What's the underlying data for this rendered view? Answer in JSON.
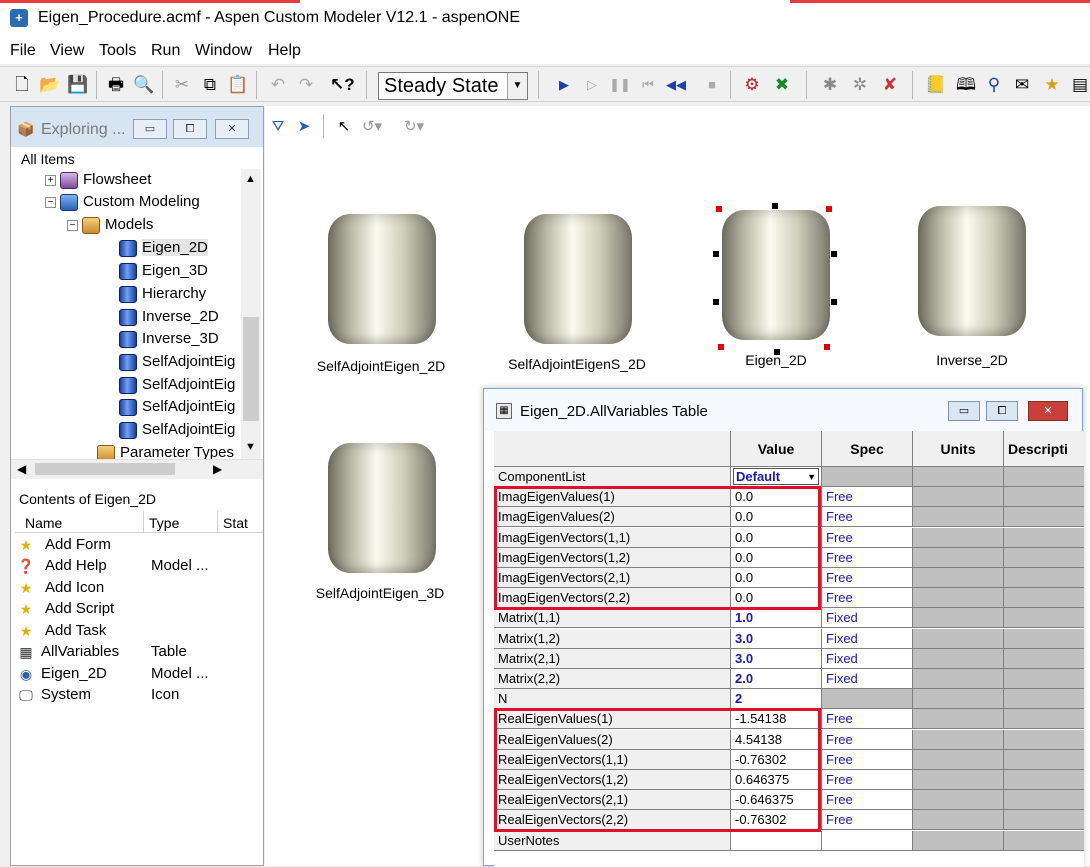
{
  "title_bar": {
    "title": "Eigen_Procedure.acmf - Aspen Custom Modeler V12.1 - aspenONE"
  },
  "menu": {
    "items": [
      "File",
      "Edit",
      "View",
      "Tools",
      "Run",
      "Window",
      "Help"
    ]
  },
  "toolbar": {
    "run_mode": "Steady State"
  },
  "explorer": {
    "caption": "Exploring ...",
    "all_items_label": "All Items",
    "tree": {
      "flowsheet": "Flowsheet",
      "custom_modeling": "Custom Modeling",
      "models": "Models",
      "model_items": [
        "Eigen_2D",
        "Eigen_3D",
        "Hierarchy",
        "Inverse_2D",
        "Inverse_3D",
        "SelfAdjointEig",
        "SelfAdjointEig",
        "SelfAdjointEig",
        "SelfAdjointEig"
      ],
      "parameter_types": "Parameter Types"
    },
    "contents_label": "Contents of Eigen_2D",
    "columns": {
      "name": "Name",
      "type": "Type",
      "status": "Stat"
    },
    "contents": [
      {
        "name": "Add Form",
        "type": ""
      },
      {
        "name": "Add Help",
        "type": "Model ..."
      },
      {
        "name": "Add Icon",
        "type": ""
      },
      {
        "name": "Add Script",
        "type": ""
      },
      {
        "name": "Add Task",
        "type": ""
      },
      {
        "name": "AllVariables",
        "type": "Table"
      },
      {
        "name": "Eigen_2D",
        "type": "Model ..."
      },
      {
        "name": "System",
        "type": "Icon"
      }
    ]
  },
  "flowsheet": {
    "blocks": [
      {
        "label": "SelfAdjointEigen_2D"
      },
      {
        "label": "SelfAdjointEigenS_2D"
      },
      {
        "label": "Eigen_2D"
      },
      {
        "label": "Inverse_2D"
      },
      {
        "label": "SelfAdjointEigen_3D"
      }
    ]
  },
  "table_window": {
    "caption": "Eigen_2D.AllVariables Table",
    "headers": {
      "value": "Value",
      "spec": "Spec",
      "units": "Units",
      "description": "Descripti"
    },
    "rows": [
      {
        "name": "ComponentList",
        "value": "Default",
        "spec": ""
      },
      {
        "name": "ImagEigenValues(1)",
        "value": "0.0",
        "spec": "Free"
      },
      {
        "name": "ImagEigenValues(2)",
        "value": "0.0",
        "spec": "Free"
      },
      {
        "name": "ImagEigenVectors(1,1)",
        "value": "0.0",
        "spec": "Free"
      },
      {
        "name": "ImagEigenVectors(1,2)",
        "value": "0.0",
        "spec": "Free"
      },
      {
        "name": "ImagEigenVectors(2,1)",
        "value": "0.0",
        "spec": "Free"
      },
      {
        "name": "ImagEigenVectors(2,2)",
        "value": "0.0",
        "spec": "Free"
      },
      {
        "name": "Matrix(1,1)",
        "value": "1.0",
        "spec": "Fixed"
      },
      {
        "name": "Matrix(1,2)",
        "value": "3.0",
        "spec": "Fixed"
      },
      {
        "name": "Matrix(2,1)",
        "value": "3.0",
        "spec": "Fixed"
      },
      {
        "name": "Matrix(2,2)",
        "value": "2.0",
        "spec": "Fixed"
      },
      {
        "name": "N",
        "value": "2",
        "spec": ""
      },
      {
        "name": "RealEigenValues(1)",
        "value": "-1.54138",
        "spec": "Free"
      },
      {
        "name": "RealEigenValues(2)",
        "value": "4.54138",
        "spec": "Free"
      },
      {
        "name": "RealEigenVectors(1,1)",
        "value": "-0.76302",
        "spec": "Free"
      },
      {
        "name": "RealEigenVectors(1,2)",
        "value": "0.646375",
        "spec": "Free"
      },
      {
        "name": "RealEigenVectors(2,1)",
        "value": "-0.646375",
        "spec": "Free"
      },
      {
        "name": "RealEigenVectors(2,2)",
        "value": "-0.76302",
        "spec": "Free"
      },
      {
        "name": "UserNotes",
        "value": "",
        "spec": ""
      }
    ]
  },
  "colors": {
    "highlight_box": "#e0102a",
    "spec_text": "#1a1ab8",
    "selection_handle": "#e00000"
  }
}
